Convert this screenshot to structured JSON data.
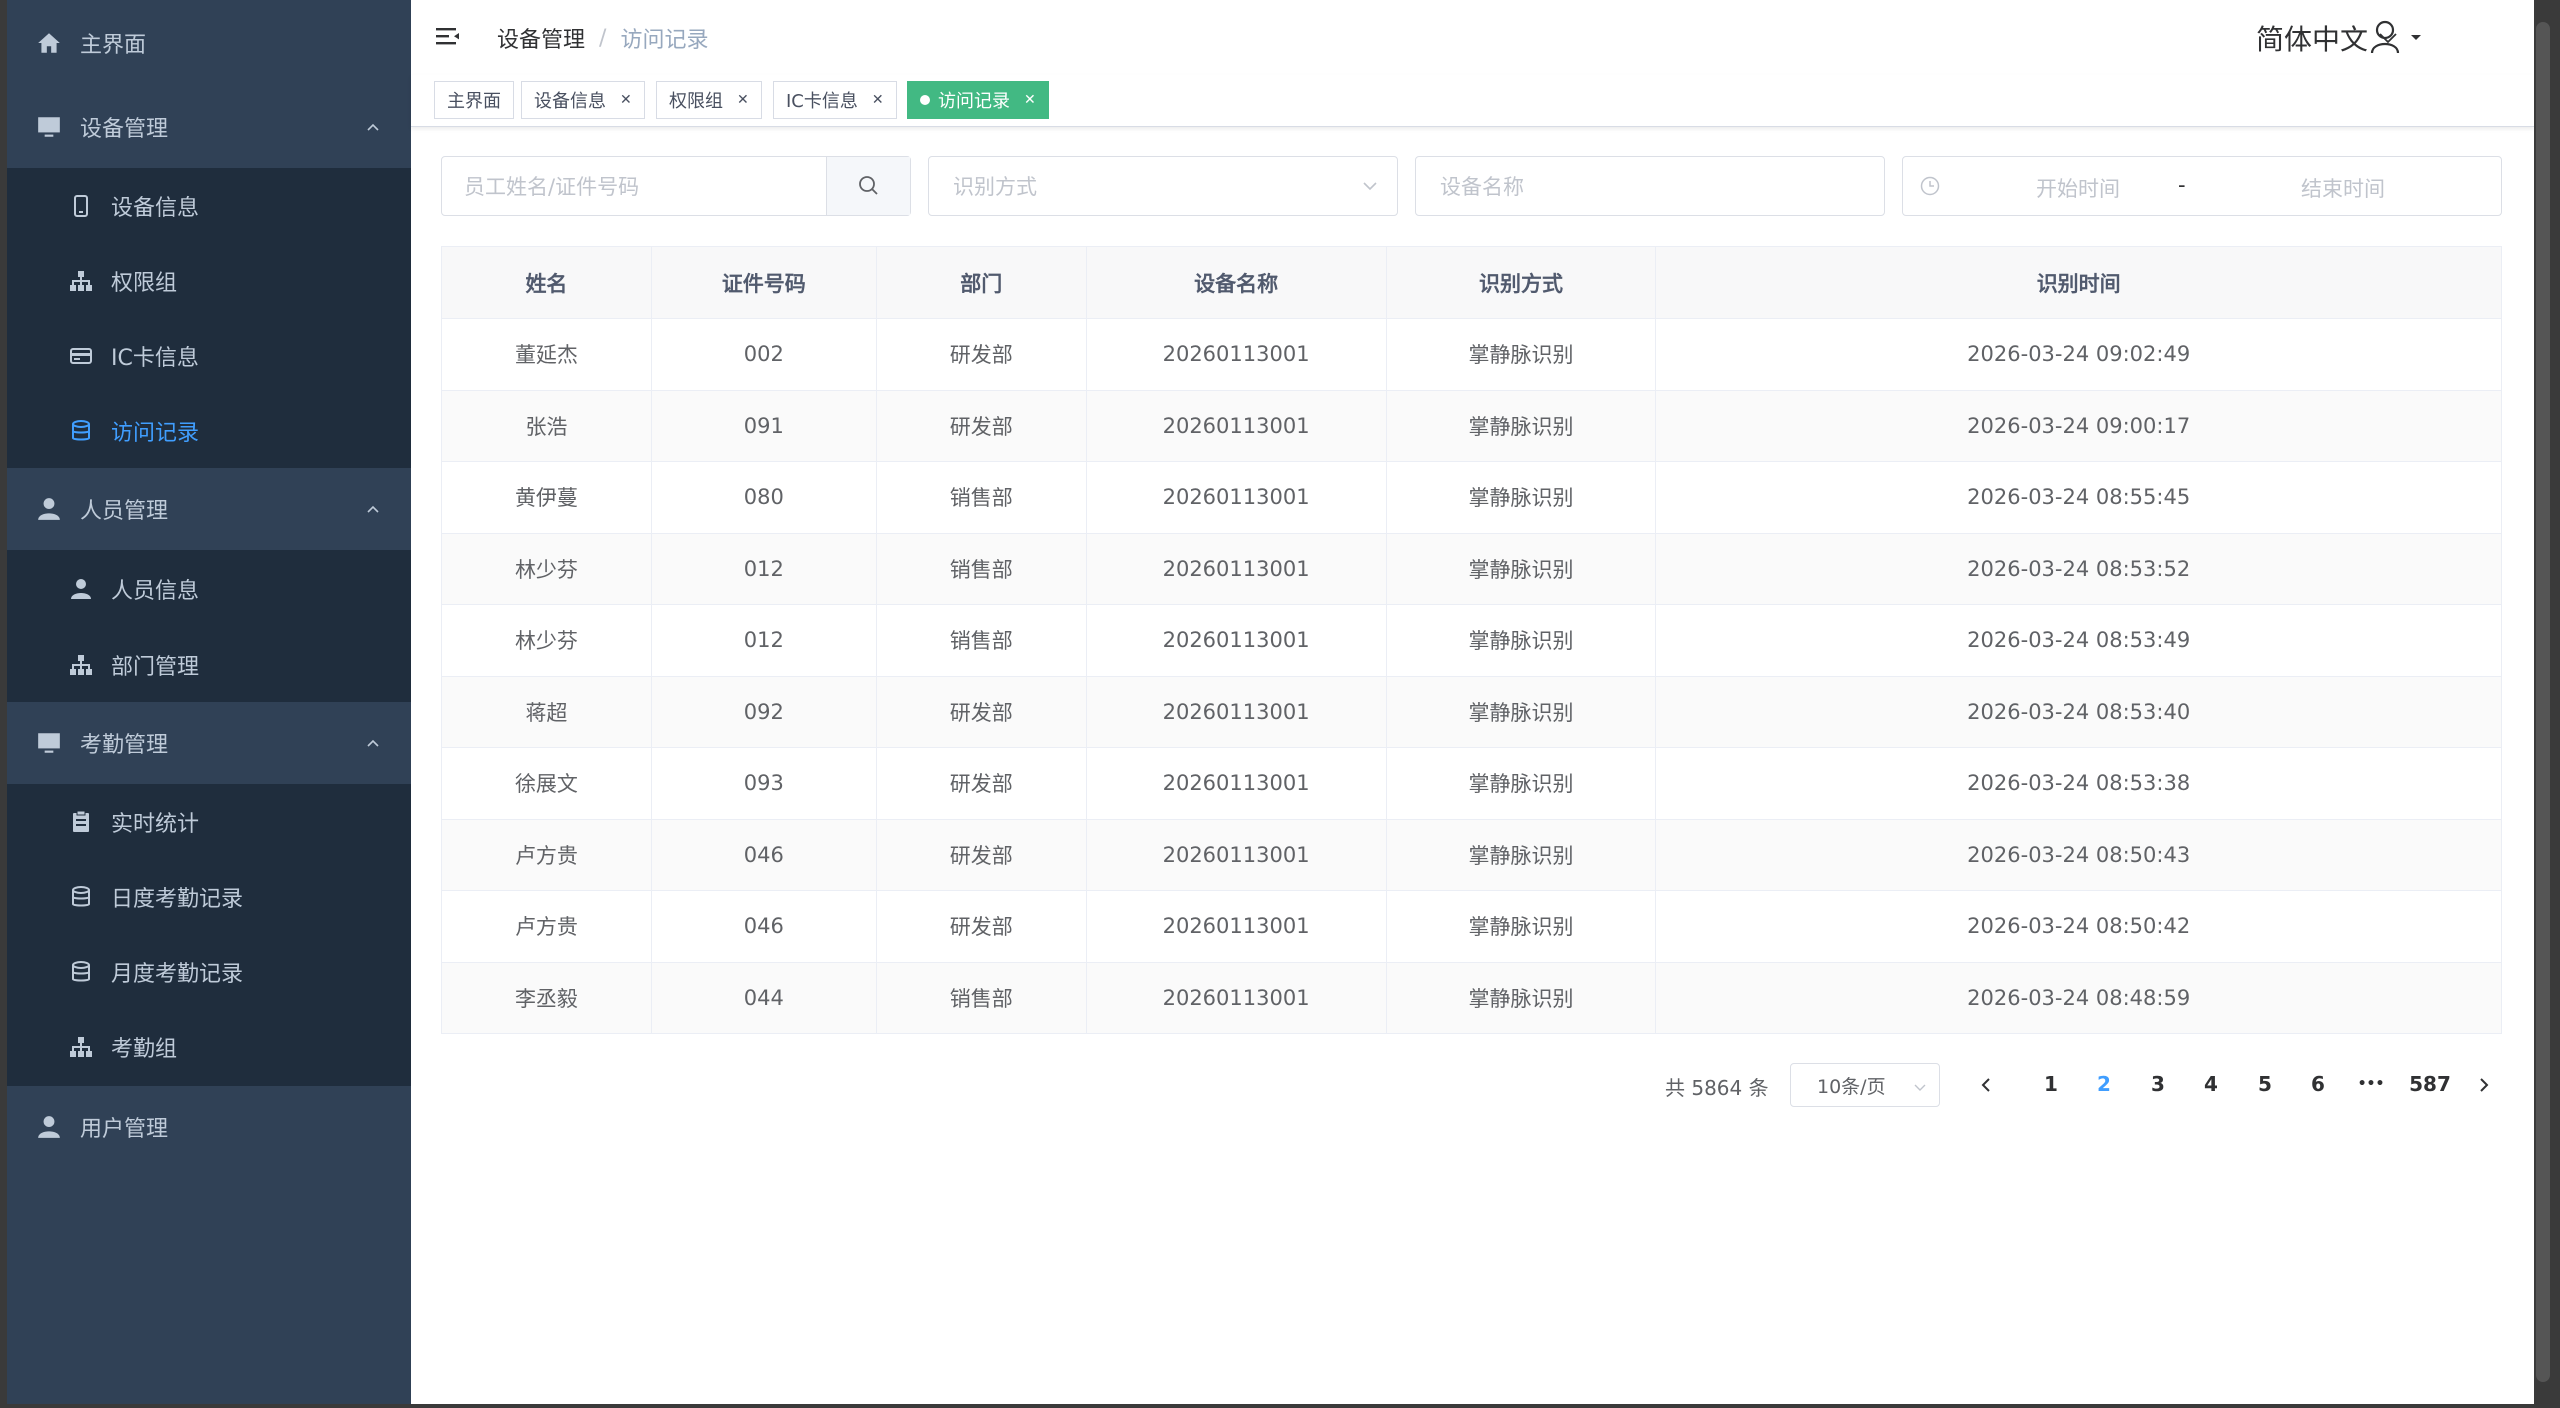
{
  "sidebar": {
    "home": "主界面",
    "device": {
      "label": "设备管理",
      "items": [
        "设备信息",
        "权限组",
        "IC卡信息",
        "访问记录"
      ]
    },
    "personnel": {
      "label": "人员管理",
      "items": [
        "人员信息",
        "部门管理"
      ]
    },
    "attendance": {
      "label": "考勤管理",
      "items": [
        "实时统计",
        "日度考勤记录",
        "月度考勤记录",
        "考勤组"
      ]
    },
    "users": "用户管理"
  },
  "navbar": {
    "breadcrumb": [
      "设备管理",
      "访问记录"
    ],
    "breadcrumb_sep": "/",
    "language": "简体中文"
  },
  "tags": [
    {
      "label": "主界面",
      "closable": false,
      "active": false
    },
    {
      "label": "设备信息",
      "closable": true,
      "active": false
    },
    {
      "label": "权限组",
      "closable": true,
      "active": false
    },
    {
      "label": "IC卡信息",
      "closable": true,
      "active": false
    },
    {
      "label": "访问记录",
      "closable": true,
      "active": true
    }
  ],
  "filters": {
    "search_placeholder": "员工姓名/证件号码",
    "method_placeholder": "识别方式",
    "device_placeholder": "设备名称",
    "start_placeholder": "开始时间",
    "range_sep": "-",
    "end_placeholder": "结束时间"
  },
  "table": {
    "columns": [
      "姓名",
      "证件号码",
      "部门",
      "设备名称",
      "识别方式",
      "识别时间"
    ],
    "rows": [
      [
        "董延杰",
        "002",
        "研发部",
        "20260113001",
        "掌静脉识别",
        "2026-03-24 09:02:49"
      ],
      [
        "张浩",
        "091",
        "研发部",
        "20260113001",
        "掌静脉识别",
        "2026-03-24 09:00:17"
      ],
      [
        "黄伊蔓",
        "080",
        "销售部",
        "20260113001",
        "掌静脉识别",
        "2026-03-24 08:55:45"
      ],
      [
        "林少芬",
        "012",
        "销售部",
        "20260113001",
        "掌静脉识别",
        "2026-03-24 08:53:52"
      ],
      [
        "林少芬",
        "012",
        "销售部",
        "20260113001",
        "掌静脉识别",
        "2026-03-24 08:53:49"
      ],
      [
        "蒋超",
        "092",
        "研发部",
        "20260113001",
        "掌静脉识别",
        "2026-03-24 08:53:40"
      ],
      [
        "徐展文",
        "093",
        "研发部",
        "20260113001",
        "掌静脉识别",
        "2026-03-24 08:53:38"
      ],
      [
        "卢方贵",
        "046",
        "研发部",
        "20260113001",
        "掌静脉识别",
        "2026-03-24 08:50:43"
      ],
      [
        "卢方贵",
        "046",
        "研发部",
        "20260113001",
        "掌静脉识别",
        "2026-03-24 08:50:42"
      ],
      [
        "李丞毅",
        "044",
        "销售部",
        "20260113001",
        "掌静脉识别",
        "2026-03-24 08:48:59"
      ]
    ]
  },
  "pagination": {
    "total_text": "共 5864 条",
    "page_size": "10条/页",
    "pages": [
      "1",
      "2",
      "3",
      "4",
      "5",
      "6"
    ],
    "current_page": "2",
    "ellipsis": "•••",
    "last_page": "587"
  },
  "colors": {
    "sidebar_bg": "#304156",
    "submenu_bg": "#1f2d3d",
    "active_link": "#409eff",
    "active_tag": "#42b983"
  }
}
